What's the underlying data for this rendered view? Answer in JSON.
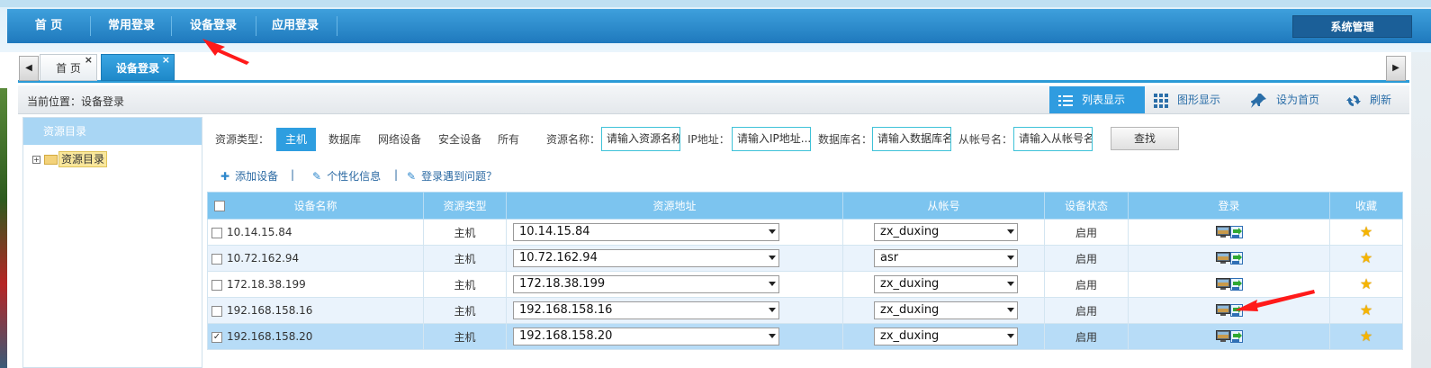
{
  "nav": {
    "items": [
      "首 页",
      "常用登录",
      "设备登录",
      "应用登录"
    ],
    "system": "系统管理"
  },
  "tabs": {
    "home": "首 页",
    "active": "设备登录",
    "close": "×"
  },
  "breadcrumb": "当前位置：设备登录",
  "views": {
    "list": "列表显示",
    "graphic": "图形显示",
    "sethome": "设为首页",
    "refresh": "刷新"
  },
  "tree": {
    "header": "资源目录",
    "item": "资源目录"
  },
  "filters": {
    "type_label": "资源类型：",
    "types": [
      "主机",
      "数据库",
      "网络设备",
      "安全设备",
      "所有"
    ],
    "name_label": "资源名称：",
    "name_placeholder": "请输入资源名称",
    "ip_label": "IP地址：",
    "ip_placeholder": "请输入IP地址...",
    "db_label": "数据库名：",
    "db_placeholder": "请输入数据库名",
    "acct_label": "从帐号名：",
    "acct_placeholder": "请输入从帐号名",
    "search_button": "查找"
  },
  "actions": {
    "add": "添加设备",
    "personalize": "个性化信息",
    "problem": "登录遇到问题？"
  },
  "table": {
    "headers": [
      "设备名称",
      "资源类型",
      "资源地址",
      "从帐号",
      "设备状态",
      "登录",
      "收藏"
    ],
    "rows": [
      {
        "name": "10.14.15.84",
        "type": "主机",
        "address": "10.14.15.84",
        "account": "zx_duxing",
        "status": "启用",
        "checked": false
      },
      {
        "name": "10.72.162.94",
        "type": "主机",
        "address": "10.72.162.94",
        "account": "asr",
        "status": "启用",
        "checked": false
      },
      {
        "name": "172.18.38.199",
        "type": "主机",
        "address": "172.18.38.199",
        "account": "zx_duxing",
        "status": "启用",
        "checked": false
      },
      {
        "name": "192.168.158.16",
        "type": "主机",
        "address": "192.168.158.16",
        "account": "zx_duxing",
        "status": "启用",
        "checked": false
      },
      {
        "name": "192.168.158.20",
        "type": "主机",
        "address": "192.168.158.20",
        "account": "zx_duxing",
        "status": "启用",
        "checked": true
      }
    ]
  },
  "colors": {
    "nav": "#2a8fd0",
    "accent": "#2e9ee0",
    "header": "#7cc4ef",
    "annotation": "#ff1a1a"
  }
}
